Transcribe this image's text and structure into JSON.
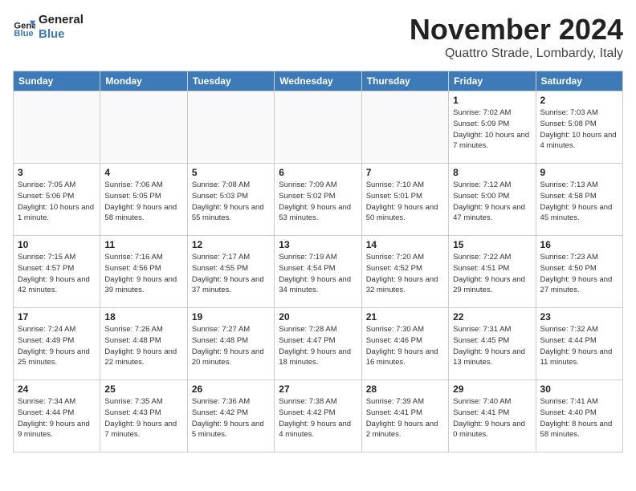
{
  "logo": {
    "line1": "General",
    "line2": "Blue",
    "tagline": ""
  },
  "title": "November 2024",
  "location": "Quattro Strade, Lombardy, Italy",
  "days_of_week": [
    "Sunday",
    "Monday",
    "Tuesday",
    "Wednesday",
    "Thursday",
    "Friday",
    "Saturday"
  ],
  "weeks": [
    [
      {
        "day": "",
        "info": ""
      },
      {
        "day": "",
        "info": ""
      },
      {
        "day": "",
        "info": ""
      },
      {
        "day": "",
        "info": ""
      },
      {
        "day": "",
        "info": ""
      },
      {
        "day": "1",
        "info": "Sunrise: 7:02 AM\nSunset: 5:09 PM\nDaylight: 10 hours and 7 minutes."
      },
      {
        "day": "2",
        "info": "Sunrise: 7:03 AM\nSunset: 5:08 PM\nDaylight: 10 hours and 4 minutes."
      }
    ],
    [
      {
        "day": "3",
        "info": "Sunrise: 7:05 AM\nSunset: 5:06 PM\nDaylight: 10 hours and 1 minute."
      },
      {
        "day": "4",
        "info": "Sunrise: 7:06 AM\nSunset: 5:05 PM\nDaylight: 9 hours and 58 minutes."
      },
      {
        "day": "5",
        "info": "Sunrise: 7:08 AM\nSunset: 5:03 PM\nDaylight: 9 hours and 55 minutes."
      },
      {
        "day": "6",
        "info": "Sunrise: 7:09 AM\nSunset: 5:02 PM\nDaylight: 9 hours and 53 minutes."
      },
      {
        "day": "7",
        "info": "Sunrise: 7:10 AM\nSunset: 5:01 PM\nDaylight: 9 hours and 50 minutes."
      },
      {
        "day": "8",
        "info": "Sunrise: 7:12 AM\nSunset: 5:00 PM\nDaylight: 9 hours and 47 minutes."
      },
      {
        "day": "9",
        "info": "Sunrise: 7:13 AM\nSunset: 4:58 PM\nDaylight: 9 hours and 45 minutes."
      }
    ],
    [
      {
        "day": "10",
        "info": "Sunrise: 7:15 AM\nSunset: 4:57 PM\nDaylight: 9 hours and 42 minutes."
      },
      {
        "day": "11",
        "info": "Sunrise: 7:16 AM\nSunset: 4:56 PM\nDaylight: 9 hours and 39 minutes."
      },
      {
        "day": "12",
        "info": "Sunrise: 7:17 AM\nSunset: 4:55 PM\nDaylight: 9 hours and 37 minutes."
      },
      {
        "day": "13",
        "info": "Sunrise: 7:19 AM\nSunset: 4:54 PM\nDaylight: 9 hours and 34 minutes."
      },
      {
        "day": "14",
        "info": "Sunrise: 7:20 AM\nSunset: 4:52 PM\nDaylight: 9 hours and 32 minutes."
      },
      {
        "day": "15",
        "info": "Sunrise: 7:22 AM\nSunset: 4:51 PM\nDaylight: 9 hours and 29 minutes."
      },
      {
        "day": "16",
        "info": "Sunrise: 7:23 AM\nSunset: 4:50 PM\nDaylight: 9 hours and 27 minutes."
      }
    ],
    [
      {
        "day": "17",
        "info": "Sunrise: 7:24 AM\nSunset: 4:49 PM\nDaylight: 9 hours and 25 minutes."
      },
      {
        "day": "18",
        "info": "Sunrise: 7:26 AM\nSunset: 4:48 PM\nDaylight: 9 hours and 22 minutes."
      },
      {
        "day": "19",
        "info": "Sunrise: 7:27 AM\nSunset: 4:48 PM\nDaylight: 9 hours and 20 minutes."
      },
      {
        "day": "20",
        "info": "Sunrise: 7:28 AM\nSunset: 4:47 PM\nDaylight: 9 hours and 18 minutes."
      },
      {
        "day": "21",
        "info": "Sunrise: 7:30 AM\nSunset: 4:46 PM\nDaylight: 9 hours and 16 minutes."
      },
      {
        "day": "22",
        "info": "Sunrise: 7:31 AM\nSunset: 4:45 PM\nDaylight: 9 hours and 13 minutes."
      },
      {
        "day": "23",
        "info": "Sunrise: 7:32 AM\nSunset: 4:44 PM\nDaylight: 9 hours and 11 minutes."
      }
    ],
    [
      {
        "day": "24",
        "info": "Sunrise: 7:34 AM\nSunset: 4:44 PM\nDaylight: 9 hours and 9 minutes."
      },
      {
        "day": "25",
        "info": "Sunrise: 7:35 AM\nSunset: 4:43 PM\nDaylight: 9 hours and 7 minutes."
      },
      {
        "day": "26",
        "info": "Sunrise: 7:36 AM\nSunset: 4:42 PM\nDaylight: 9 hours and 5 minutes."
      },
      {
        "day": "27",
        "info": "Sunrise: 7:38 AM\nSunset: 4:42 PM\nDaylight: 9 hours and 4 minutes."
      },
      {
        "day": "28",
        "info": "Sunrise: 7:39 AM\nSunset: 4:41 PM\nDaylight: 9 hours and 2 minutes."
      },
      {
        "day": "29",
        "info": "Sunrise: 7:40 AM\nSunset: 4:41 PM\nDaylight: 9 hours and 0 minutes."
      },
      {
        "day": "30",
        "info": "Sunrise: 7:41 AM\nSunset: 4:40 PM\nDaylight: 8 hours and 58 minutes."
      }
    ]
  ]
}
